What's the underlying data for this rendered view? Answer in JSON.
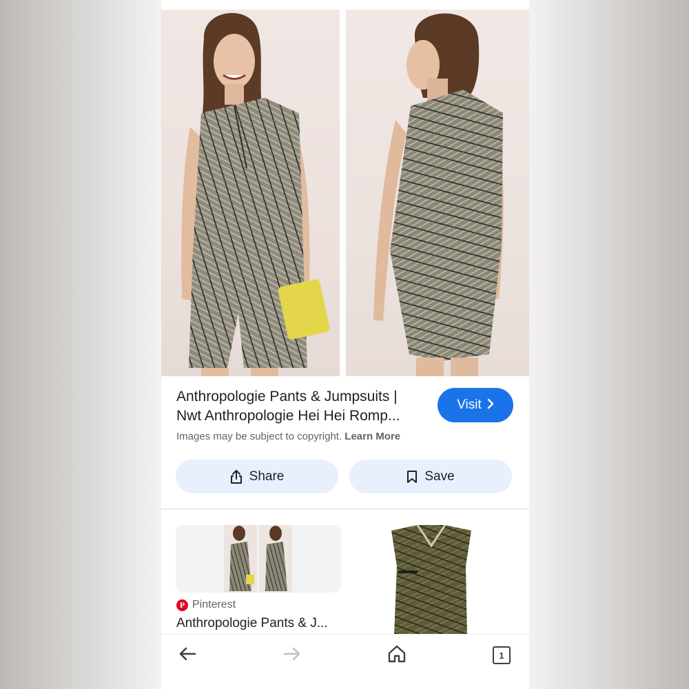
{
  "result": {
    "title_line1": "Anthropologie Pants & Jumpsuits |",
    "title_line2": "Nwt Anthropologie Hei Hei Romp...",
    "copyright_text": "Images may be subject to copyright.",
    "learn_more": "Learn More",
    "visit_label": "Visit",
    "visit_icon": "chevron-right-icon",
    "accent_color": "#1a73e8"
  },
  "actions": {
    "share_label": "Share",
    "share_icon": "share-icon",
    "save_label": "Save",
    "save_icon": "bookmark-icon",
    "button_bg": "#e8f0fe"
  },
  "related": [
    {
      "source": "Pinterest",
      "source_icon": "pinterest-icon",
      "title": "Anthropologie Pants & J..."
    },
    {
      "source": "",
      "title": ""
    }
  ],
  "bottom_nav": {
    "back_icon": "back-arrow-icon",
    "forward_icon": "forward-arrow-icon",
    "home_icon": "home-icon",
    "tab_count": "1"
  }
}
